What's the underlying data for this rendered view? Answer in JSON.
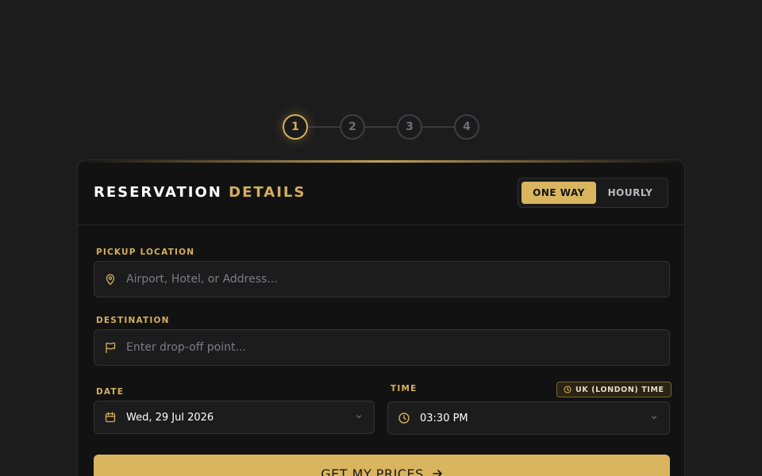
{
  "stepper": {
    "steps": [
      "1",
      "2",
      "3",
      "4"
    ],
    "active_index": 0
  },
  "card": {
    "title_main": "RESERVATION",
    "title_accent": "DETAILS",
    "trip_type": {
      "options": [
        "ONE WAY",
        "HOURLY"
      ],
      "selected": "ONE WAY"
    }
  },
  "pickup": {
    "label": "PICKUP LOCATION",
    "placeholder": "Airport, Hotel, or Address...",
    "value": ""
  },
  "destination": {
    "label": "DESTINATION",
    "placeholder": "Enter drop-off point...",
    "value": ""
  },
  "date": {
    "label": "DATE",
    "value": "Wed, 29 Jul 2026"
  },
  "time": {
    "label": "TIME",
    "value": "03:30 PM",
    "timezone_badge": "UK (LONDON) TIME"
  },
  "cta": {
    "label": "GET MY PRICES"
  },
  "colors": {
    "accent": "#d4af5c",
    "button": "#d8b55e",
    "background": "#1c1c1d",
    "card": "#121213"
  },
  "icons": {
    "pickup": "map-pin-icon",
    "destination": "flag-icon",
    "date": "calendar-icon",
    "time": "clock-icon",
    "dropdown": "chevron-down-icon",
    "cta": "arrow-right-icon"
  }
}
